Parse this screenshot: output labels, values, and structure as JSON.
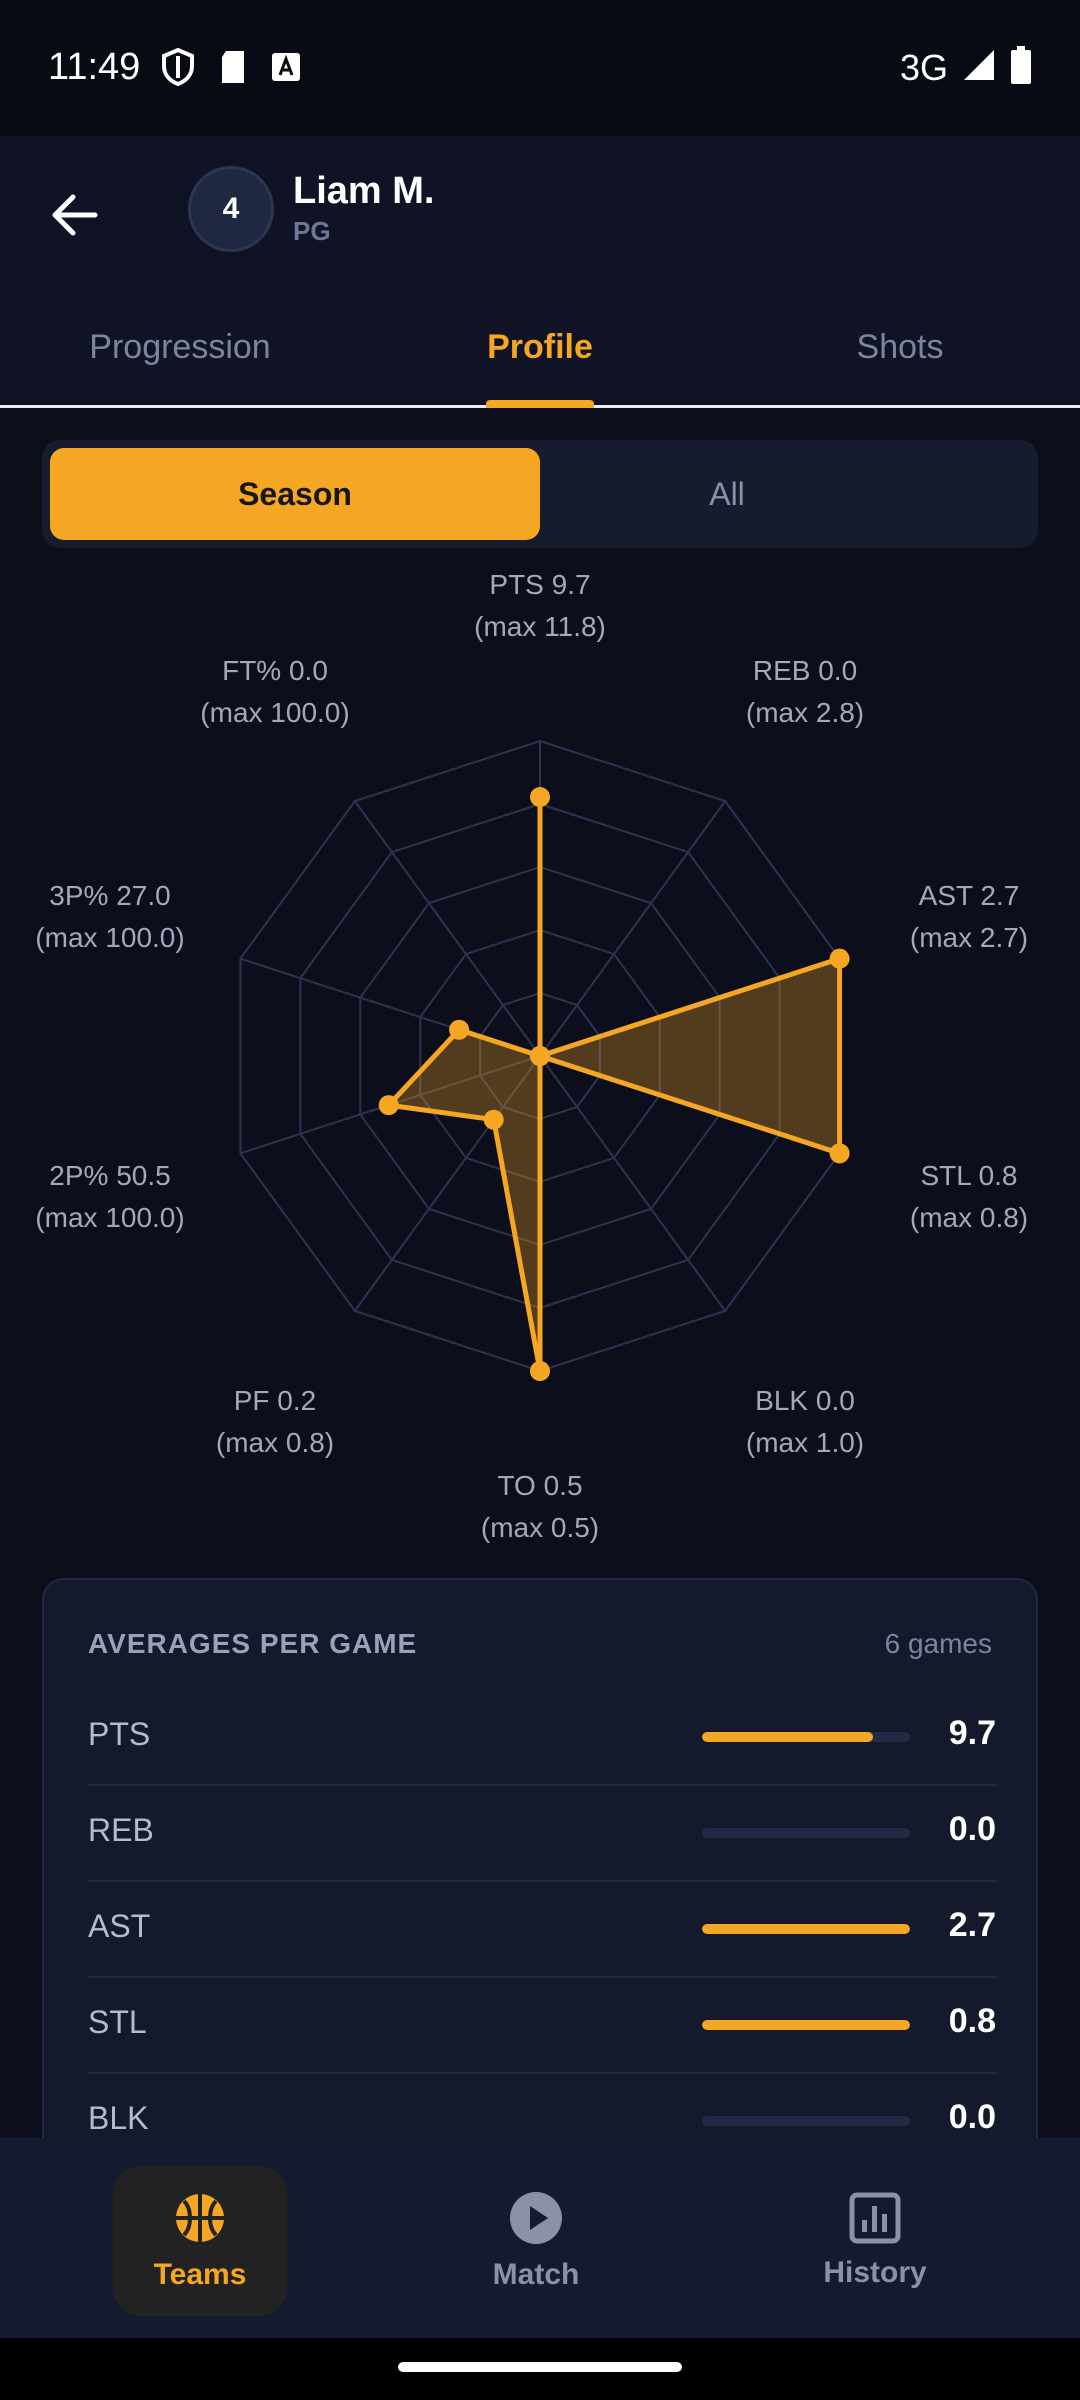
{
  "status_bar": {
    "time": "11:49",
    "network": "3G",
    "icons": [
      "shield-icon",
      "sd-card-icon",
      "font-icon",
      "signal-icon",
      "battery-icon"
    ]
  },
  "header": {
    "player_number": "4",
    "player_name": "Liam M.",
    "player_position": "PG"
  },
  "tabs": [
    {
      "label": "Progression",
      "active": false
    },
    {
      "label": "Profile",
      "active": true
    },
    {
      "label": "Shots",
      "active": false
    }
  ],
  "toggle": {
    "season": "Season",
    "all": "All",
    "selected": "Season"
  },
  "radar": {
    "labels": [
      {
        "line1": "PTS 9.7",
        "line2": "(max 11.8)"
      },
      {
        "line1": "REB 0.0",
        "line2": "(max 2.8)"
      },
      {
        "line1": "AST 2.7",
        "line2": "(max 2.7)"
      },
      {
        "line1": "STL 0.8",
        "line2": "(max 0.8)"
      },
      {
        "line1": "BLK 0.0",
        "line2": "(max 1.0)"
      },
      {
        "line1": "TO 0.5",
        "line2": "(max 0.5)"
      },
      {
        "line1": "PF 0.2",
        "line2": "(max 0.8)"
      },
      {
        "line1": "2P% 50.5",
        "line2": "(max 100.0)"
      },
      {
        "line1": "3P% 27.0",
        "line2": "(max 100.0)"
      },
      {
        "line1": "FT% 0.0",
        "line2": "(max 100.0)"
      }
    ],
    "values": [
      9.7,
      0.0,
      2.7,
      0.8,
      0.0,
      0.5,
      0.2,
      50.5,
      27.0,
      0.0
    ],
    "maxes": [
      11.8,
      2.8,
      2.7,
      0.8,
      1.0,
      0.5,
      0.8,
      100.0,
      100.0,
      100.0
    ],
    "accent": "#f5a623"
  },
  "averages": {
    "title": "AVERAGES PER GAME",
    "games": "6 games",
    "rows": [
      {
        "label": "PTS",
        "value": "9.7",
        "fill": 0.82
      },
      {
        "label": "REB",
        "value": "0.0",
        "fill": 0
      },
      {
        "label": "AST",
        "value": "2.7",
        "fill": 1
      },
      {
        "label": "STL",
        "value": "0.8",
        "fill": 1
      },
      {
        "label": "BLK",
        "value": "0.0",
        "fill": 0
      }
    ]
  },
  "bottom_nav": [
    {
      "label": "Teams",
      "icon": "basketball-icon",
      "active": true
    },
    {
      "label": "Match",
      "icon": "play-icon",
      "active": false
    },
    {
      "label": "History",
      "icon": "bar-chart-icon",
      "active": false
    }
  ]
}
